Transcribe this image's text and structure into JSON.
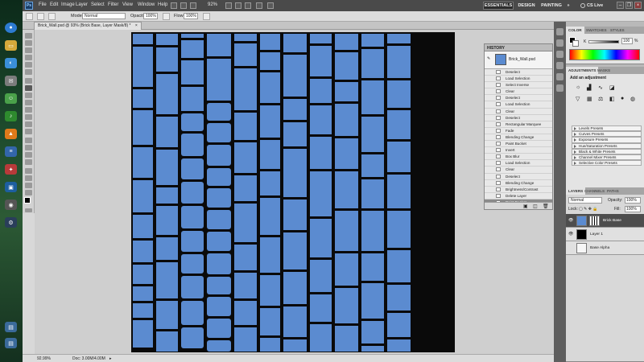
{
  "menubar": {
    "items": [
      "File",
      "Edit",
      "Image",
      "Layer",
      "Select",
      "Filter",
      "View",
      "Window",
      "Help"
    ],
    "zoom": "92%",
    "workspaces": [
      "ESSENTIALS",
      "DESIGN",
      "PAINTING"
    ],
    "more": "»",
    "cs_live": "CS Live",
    "logo": "Ps"
  },
  "options": {
    "mode_label": "Mode:",
    "mode_value": "Normal",
    "opacity_label": "Opacity:",
    "opacity_value": "100%",
    "flow_label": "Flow:",
    "flow_value": "100%"
  },
  "document": {
    "tab_title": "Brick_Wall.psd @ 93% (Brick Base, Layer Mask/8) *",
    "close": "×"
  },
  "status": {
    "zoom": "92.99%",
    "doc": "Doc: 3.00M/4.00M"
  },
  "history": {
    "title": "HISTORY",
    "snapshot": "Brick_Wall.psd",
    "items": [
      "Deselect",
      "Load Selection",
      "Select Inverse",
      "Clear",
      "Deselect",
      "Load Selection",
      "Clear",
      "Deselect",
      "Rectangular Marquee",
      "Fade",
      "Blending Change",
      "Paint Bucket",
      "Invert",
      "Box Blur",
      "Load Selection",
      "Clear",
      "Deselect",
      "Blending Change",
      "Brightness/Contrast",
      "Delete Layer",
      "Paint Bucket"
    ]
  },
  "color_panel": {
    "tabs": [
      "COLOR",
      "SWATCHES",
      "STYLES"
    ],
    "k_label": "K",
    "k_value": "100",
    "pct": "%"
  },
  "adjustments": {
    "tabs": [
      "ADJUSTMENTS",
      "MASKS"
    ],
    "heading": "Add an adjustment",
    "presets": [
      "Levels Presets",
      "Curves Presets",
      "Exposure Presets",
      "Hue/Saturation Presets",
      "Black & White Presets",
      "Channel Mixer Presets",
      "Selective Color Presets"
    ]
  },
  "layers": {
    "tabs": [
      "LAYERS",
      "CHANNELS",
      "PATHS"
    ],
    "blend": "Normal",
    "opacity_label": "Opacity:",
    "opacity_value": "100%",
    "lock_label": "Lock:",
    "fill_label": "Fill:",
    "fill_value": "100%",
    "items": [
      {
        "name": "Brick Base"
      },
      {
        "name": "Layer 1"
      },
      {
        "name": "Base Alpha"
      }
    ]
  },
  "colors": {
    "brick": "#5b8bd0",
    "mortar": "#0a0a0a",
    "ui_dark": "#4a4a4a",
    "ui_light": "#dcdcdc"
  }
}
